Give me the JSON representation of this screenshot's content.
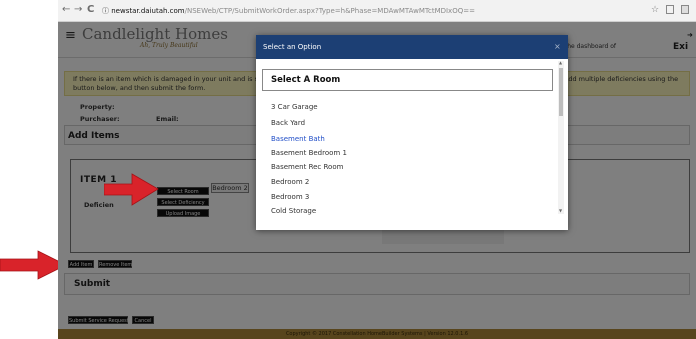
{
  "browser": {
    "address_host": "newstar.daiutah.com",
    "address_path": "/NSEWeb/CTP/SubmitWorkOrder.aspx?Type=h&Phase=MDAwMTAwMTctMDIxOQ==",
    "back_glyph": "←",
    "forward_glyph": "→",
    "reload_glyph": "C",
    "info_glyph": "ⓘ",
    "star_glyph": "☆"
  },
  "header": {
    "menu_glyph": "≡",
    "logo_main": "Candlelight Homes",
    "logo_tagline": "Ah, Truly Beautiful",
    "dashboard_text": "You are viewing the dashboard of",
    "exit_label": "Exi"
  },
  "notice": {
    "text": "If there is an item which is damaged in your unit and is stil",
    "text_line2": "button below, and then submit the form.",
    "text_right": "perty manager. Add multiple deficiencies using the"
  },
  "info": {
    "property_label": "Property:",
    "purchaser_label": "Purchaser:",
    "email_label": "Email:"
  },
  "add_items": {
    "title": "Add Items"
  },
  "item": {
    "title": "ITEM 1",
    "deficiency_label": "Deficien",
    "select_room_button": "Select Room",
    "select_deficiency_button": "Select Deficiency",
    "upload_image_button": "Upload Image",
    "selected_room": "Bedroom 2"
  },
  "actions": {
    "add_item_button": "Add Item",
    "remove_item_button": "Remove Item"
  },
  "submit": {
    "title": "Submit",
    "submit_request_button": "Submit Service Request",
    "cancel_button": "Cancel"
  },
  "footer": {
    "text": "Copyright © 2017 Constellation HomeBuilder Systems  |  Version 12.0.1.6"
  },
  "modal": {
    "title": "Select an Option",
    "close_glyph": "×",
    "select_header": "Select A Room",
    "options": [
      "3 Car Garage",
      "Back Yard",
      "Basement Bath",
      "Basement Bedroom 1",
      "Basement Rec Room",
      "Bedroom 2",
      "Bedroom 3",
      "Cold Storage"
    ],
    "selected_option": "Basement Bath"
  },
  "colors": {
    "modal_header": "#1c3f74",
    "selected_option": "#2350c8",
    "footer": "#b18b3a",
    "notice_bg": "#fcf6bf",
    "arrow": "#d9232a"
  }
}
